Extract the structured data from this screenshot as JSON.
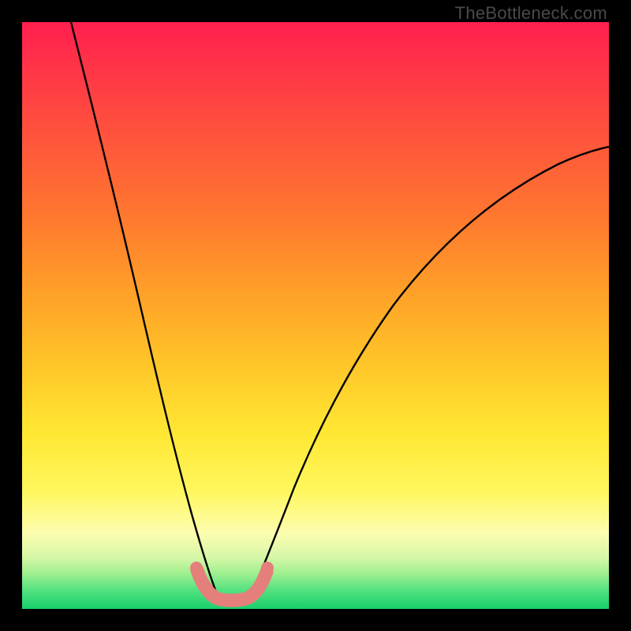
{
  "watermark": "TheBottleneck.com",
  "colors": {
    "curve_stroke": "#000000",
    "band_stroke": "#e57f7b",
    "frame_bg": "#000000"
  },
  "chart_data": {
    "type": "line",
    "title": "",
    "xlabel": "",
    "ylabel": "",
    "xlim": [
      0,
      100
    ],
    "ylim": [
      0,
      100
    ],
    "grid": false,
    "legend": false,
    "series": [
      {
        "name": "left-curve",
        "x": [
          0,
          4,
          8,
          12,
          16,
          20,
          23,
          26,
          28,
          30,
          31.5,
          33
        ],
        "values": [
          100,
          89,
          78,
          66,
          54,
          41,
          30,
          20,
          13,
          7,
          3,
          1.5
        ]
      },
      {
        "name": "right-curve",
        "x": [
          38,
          40,
          43,
          47,
          52,
          58,
          65,
          73,
          82,
          91,
          100
        ],
        "values": [
          1.5,
          4,
          10,
          19,
          30,
          41,
          51,
          60,
          68,
          74,
          79
        ]
      },
      {
        "name": "minimum-band",
        "x": [
          29,
          31,
          33,
          35,
          37,
          39
        ],
        "values": [
          5,
          2,
          1,
          1,
          2,
          5
        ]
      }
    ],
    "notes": "Red-to-green vertical gradient background; two black curves forming a V with minimum near x≈35; thick pink band highlights the minimum region."
  }
}
